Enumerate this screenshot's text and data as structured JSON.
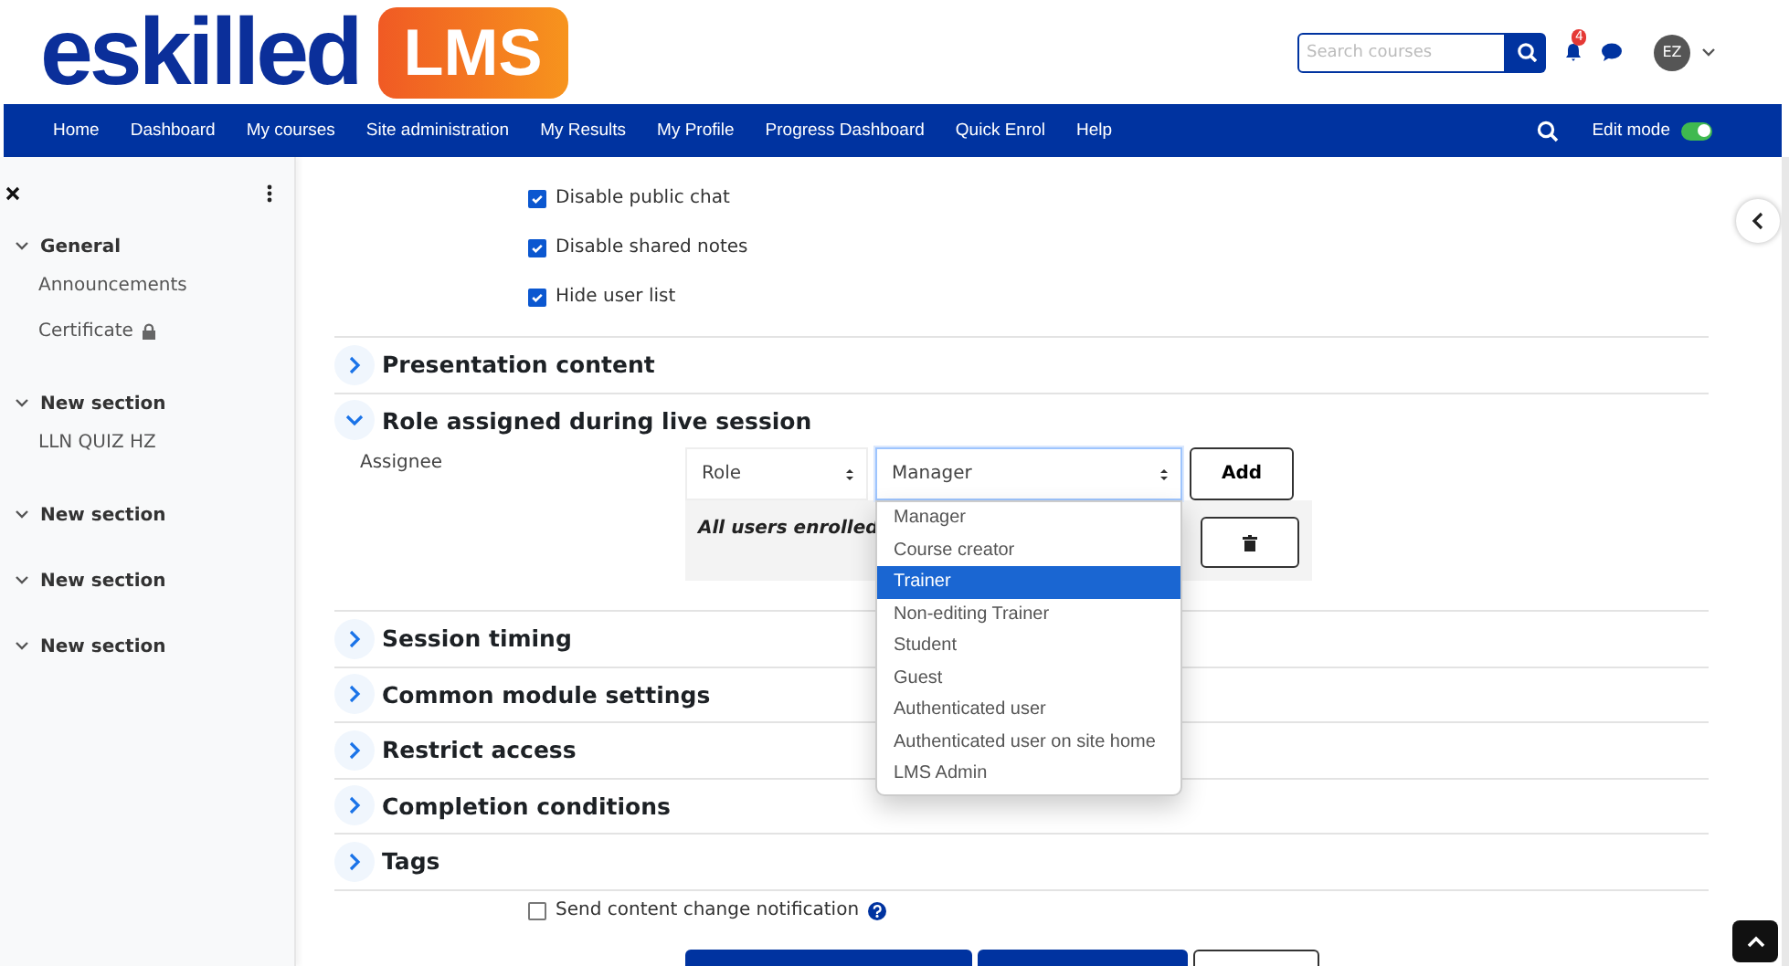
{
  "header": {
    "logo": {
      "name": "eskilled",
      "badge": "LMS"
    },
    "search": {
      "placeholder": "Search courses"
    },
    "notifications": {
      "count": "4"
    },
    "avatar": {
      "initials": "EZ"
    }
  },
  "nav": {
    "items": [
      "Home",
      "Dashboard",
      "My courses",
      "Site administration",
      "My Results",
      "My Profile",
      "Progress Dashboard",
      "Quick Enrol",
      "Help"
    ],
    "edit_mode": {
      "label": "Edit mode",
      "on": true
    }
  },
  "sidebar": {
    "sections": [
      {
        "title": "General",
        "expanded": true,
        "children": [
          {
            "label": "Announcements",
            "locked": false
          },
          {
            "label": "Certificate",
            "locked": true
          }
        ]
      },
      {
        "title": "New section",
        "expanded": true,
        "children": [
          {
            "label": "LLN QUIZ HZ",
            "locked": false
          }
        ]
      },
      {
        "title": "New section",
        "expanded": true
      },
      {
        "title": "New section",
        "expanded": true
      },
      {
        "title": "New section",
        "expanded": true
      }
    ]
  },
  "form": {
    "checkboxes": [
      {
        "label": "Disable public chat",
        "checked": true
      },
      {
        "label": "Disable shared notes",
        "checked": true
      },
      {
        "label": "Hide user list",
        "checked": true
      }
    ],
    "sections": [
      {
        "title": "Presentation content",
        "expanded": false
      },
      {
        "title": "Role assigned during live session",
        "expanded": true,
        "assignee": {
          "label": "Assignee",
          "type_select": "Role",
          "value_select": "Manager",
          "add_button": "Add",
          "assigned": "All users enrolled",
          "dropdown": [
            {
              "label": "Manager",
              "selected": false
            },
            {
              "label": "Course creator",
              "selected": false
            },
            {
              "label": "Trainer",
              "selected": true
            },
            {
              "label": "Non-editing Trainer",
              "selected": false
            },
            {
              "label": "Student",
              "selected": false
            },
            {
              "label": "Guest",
              "selected": false
            },
            {
              "label": "Authenticated user",
              "selected": false
            },
            {
              "label": "Authenticated user on site home",
              "selected": false
            },
            {
              "label": "LMS Admin",
              "selected": false
            }
          ]
        }
      },
      {
        "title": "Session timing",
        "expanded": false
      },
      {
        "title": "Common module settings",
        "expanded": false
      },
      {
        "title": "Restrict access",
        "expanded": false
      },
      {
        "title": "Completion conditions",
        "expanded": false
      },
      {
        "title": "Tags",
        "expanded": false
      }
    ],
    "notify": {
      "label": "Send content change notification",
      "checked": false
    },
    "bottom_buttons": [
      {
        "kind": "primary"
      },
      {
        "kind": "primary"
      },
      {
        "kind": "secondary"
      }
    ]
  }
}
